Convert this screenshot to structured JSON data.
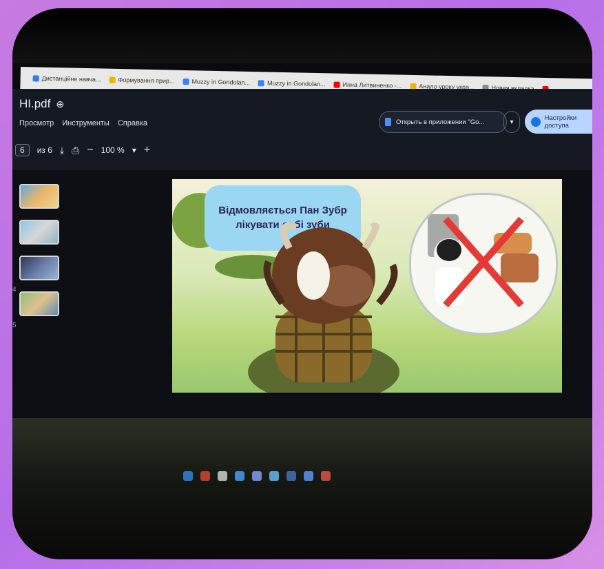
{
  "browser": {
    "tabs": [
      {
        "label": "Дистанційне навча...",
        "color": "#2e7cf6"
      },
      {
        "label": "Формування прир...",
        "color": "#f1b400"
      },
      {
        "label": "Muzzy in Gondolan...",
        "color": "#3b82f6"
      },
      {
        "label": "Muzzy in Gondolan...",
        "color": "#3b82f6"
      },
      {
        "label": "Инна Литвиненко -...",
        "color": "#ff0000"
      },
      {
        "label": "Анало уроку укра...",
        "color": "#f1b400"
      },
      {
        "label": "Новая вкладка",
        "color": "#888888"
      },
      {
        "label": "",
        "color": "#ff0000"
      }
    ]
  },
  "pdf_viewer": {
    "file_name": "HI.pdf",
    "menu": [
      "Просмотр",
      "Инструменты",
      "Справка"
    ],
    "open_in_app": "Открыть в приложении \"Go...",
    "share": "Настройки доступа",
    "toolbar": {
      "page_current": "6",
      "page_total": "из 6",
      "zoom": "100 %"
    },
    "page_numbers": [
      "4",
      "5"
    ],
    "slide": {
      "caption": "Відмовляється Пан Зубр лікувати собі зуби"
    }
  },
  "colors": {
    "accent_blue": "#1a73e8",
    "app_bg": "#151922",
    "slide_bubble": "#9bd7f3"
  }
}
